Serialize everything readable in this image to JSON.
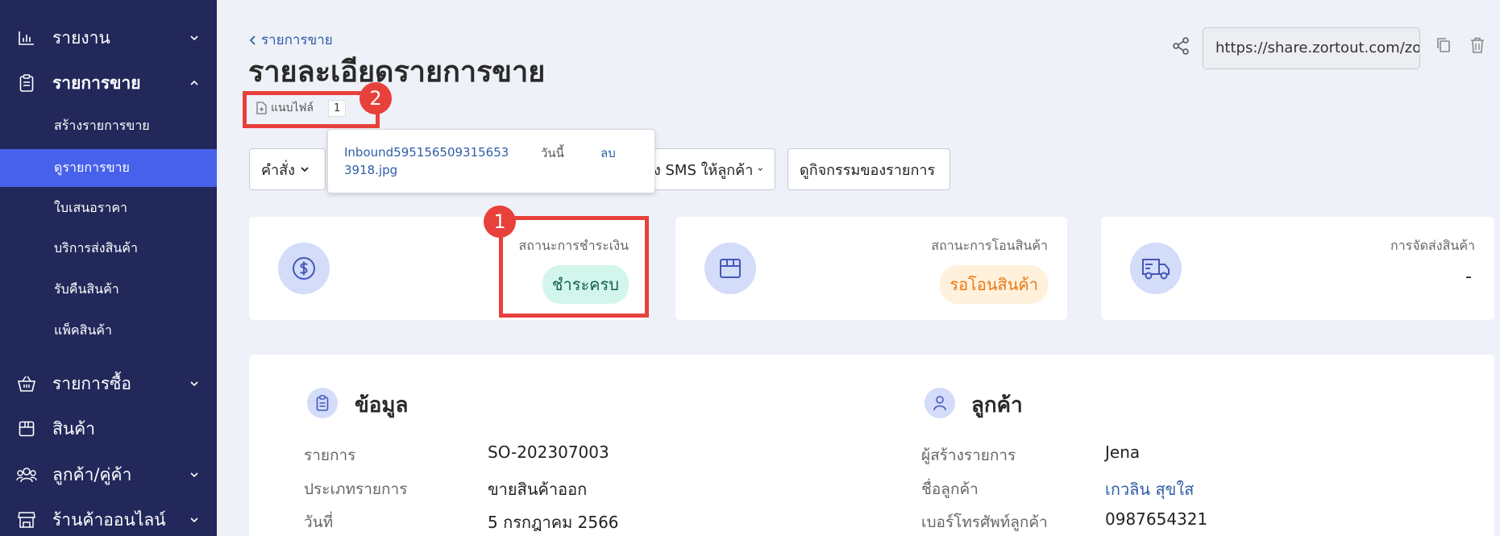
{
  "sidebar": {
    "items": [
      {
        "label": "รายงาน",
        "icon": "bar-chart-icon"
      },
      {
        "label": "รายการขาย",
        "icon": "clipboard-icon"
      },
      {
        "label": "รายการซื้อ",
        "icon": "basket-icon"
      },
      {
        "label": "สินค้า",
        "icon": "box-icon"
      },
      {
        "label": "ลูกค้า/คู่ค้า",
        "icon": "users-icon"
      },
      {
        "label": "ร้านค้าออนไลน์",
        "icon": "store-icon"
      }
    ],
    "sales_subitems": [
      "สร้างรายการขาย",
      "ดูรายการขาย",
      "ใบเสนอราคา",
      "บริการส่งสินค้า",
      "รับคืนสินค้า",
      "แพ็คสินค้า"
    ],
    "active_subitem": "ดูรายการขาย",
    "background": "#22285a",
    "active_color": "#4761ea"
  },
  "header": {
    "breadcrumb": "รายการขาย",
    "title": "รายละเอียดรายการขาย",
    "share_url": "https://share.zortout.com/zo"
  },
  "attachment": {
    "label": "แนบไฟล์",
    "count": "1",
    "file_name": "Inbound5951565093156533918.jpg",
    "date": "วันนี้",
    "delete_label": "ลบ"
  },
  "markers": {
    "one": "1",
    "two": "2"
  },
  "toolbar": {
    "command_label": "คำสั่ง",
    "sms_label": "ส่ง SMS ให้ลูกค้า",
    "activity_label": "ดูกิจกรรมของรายการ"
  },
  "status": {
    "payment": {
      "label": "สถานะการชำระเงิน",
      "value": "ชำระครบ"
    },
    "transfer": {
      "label": "สถานะการโอนสินค้า",
      "value": "รอโอนสินค้า"
    },
    "shipping": {
      "label": "การจัดส่งสินค้า",
      "value": "-"
    }
  },
  "info": {
    "title": "ข้อมูล",
    "fields": [
      {
        "label": "รายการ",
        "value": "SO-202307003"
      },
      {
        "label": "ประเภทรายการ",
        "value": "ขายสินค้าออก"
      },
      {
        "label": "วันที่",
        "value": "5 กรกฎาคม 2566"
      }
    ]
  },
  "customer": {
    "title": "ลูกค้า",
    "fields": [
      {
        "label": "ผู้สร้างรายการ",
        "value": "Jena"
      },
      {
        "label": "ชื่อลูกค้า",
        "value": "เกวลิน สุขใส"
      },
      {
        "label": "เบอร์โทรศัพท์ลูกค้า",
        "value": "0987654321"
      }
    ]
  },
  "colors": {
    "highlight": "#e8403b",
    "link": "#2f5da8",
    "page_bg": "#eef1f8"
  }
}
